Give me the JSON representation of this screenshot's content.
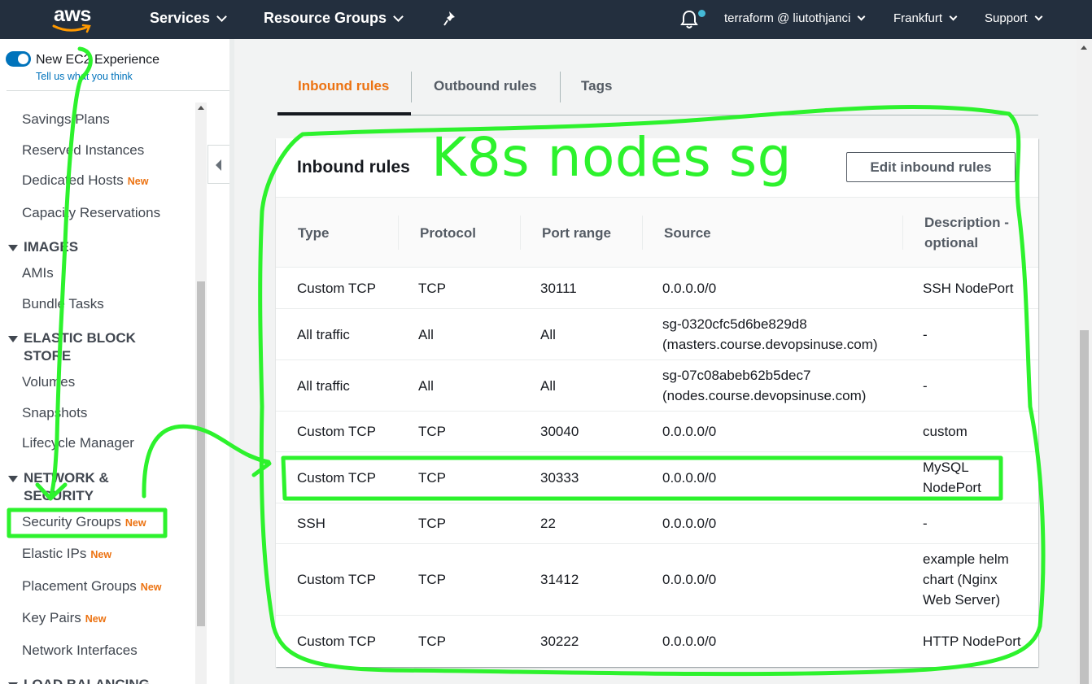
{
  "topnav": {
    "logo": "aws",
    "services": "Services",
    "resource_groups": "Resource Groups",
    "account": "terraform @ liutothjanci",
    "region": "Frankfurt",
    "support": "Support"
  },
  "sidebar": {
    "new_experience": "New EC2 Experience",
    "feedback_link": "Tell us what you think",
    "new_badge": "New",
    "items_top": [
      {
        "label": "Savings Plans"
      },
      {
        "label": "Reserved Instances"
      },
      {
        "label": "Dedicated Hosts"
      },
      {
        "label": "Capacity Reservations"
      }
    ],
    "images_section": "IMAGES",
    "images_items": [
      {
        "label": "AMIs"
      },
      {
        "label": "Bundle Tasks"
      }
    ],
    "ebs_section": "ELASTIC BLOCK STORE",
    "ebs_items": [
      {
        "label": "Volumes"
      },
      {
        "label": "Snapshots"
      },
      {
        "label": "Lifecycle Manager"
      }
    ],
    "network_section": "NETWORK & SECURITY",
    "network_items": [
      {
        "label": "Security Groups"
      },
      {
        "label": "Elastic IPs"
      },
      {
        "label": "Placement Groups"
      },
      {
        "label": "Key Pairs"
      },
      {
        "label": "Network Interfaces"
      }
    ],
    "lb_section": "LOAD BALANCING"
  },
  "tabs": [
    {
      "label": "Inbound rules",
      "active": true
    },
    {
      "label": "Outbound rules",
      "active": false
    },
    {
      "label": "Tags",
      "active": false
    }
  ],
  "panel": {
    "title": "Inbound rules",
    "edit_button": "Edit inbound rules",
    "columns": [
      "Type",
      "Protocol",
      "Port range",
      "Source",
      "Description - optional"
    ],
    "rows": [
      {
        "type": "Custom TCP",
        "protocol": "TCP",
        "port": "30111",
        "source": "0.0.0.0/0",
        "description": "SSH NodePort"
      },
      {
        "type": "All traffic",
        "protocol": "All",
        "port": "All",
        "source": "sg-0320cfc5d6be829d8 (masters.course.devopsinuse.com)",
        "description": "-"
      },
      {
        "type": "All traffic",
        "protocol": "All",
        "port": "All",
        "source": "sg-07c08abeb62b5dec7 (nodes.course.devopsinuse.com)",
        "description": "-"
      },
      {
        "type": "Custom TCP",
        "protocol": "TCP",
        "port": "30040",
        "source": "0.0.0.0/0",
        "description": "custom"
      },
      {
        "type": "Custom TCP",
        "protocol": "TCP",
        "port": "30333",
        "source": "0.0.0.0/0",
        "description": "MySQL NodePort"
      },
      {
        "type": "SSH",
        "protocol": "TCP",
        "port": "22",
        "source": "0.0.0.0/0",
        "description": "-"
      },
      {
        "type": "Custom TCP",
        "protocol": "TCP",
        "port": "31412",
        "source": "0.0.0.0/0",
        "description": "example helm chart (Nginx Web Server)"
      },
      {
        "type": "Custom TCP",
        "protocol": "TCP",
        "port": "30222",
        "source": "0.0.0.0/0",
        "description": "HTTP NodePort"
      }
    ]
  },
  "annotation": {
    "text": "K8s nodes sg",
    "color": "#2df22d"
  },
  "colors": {
    "nav_bg": "#232f3e",
    "accent_orange": "#ec7211",
    "link_blue": "#0073bb"
  }
}
